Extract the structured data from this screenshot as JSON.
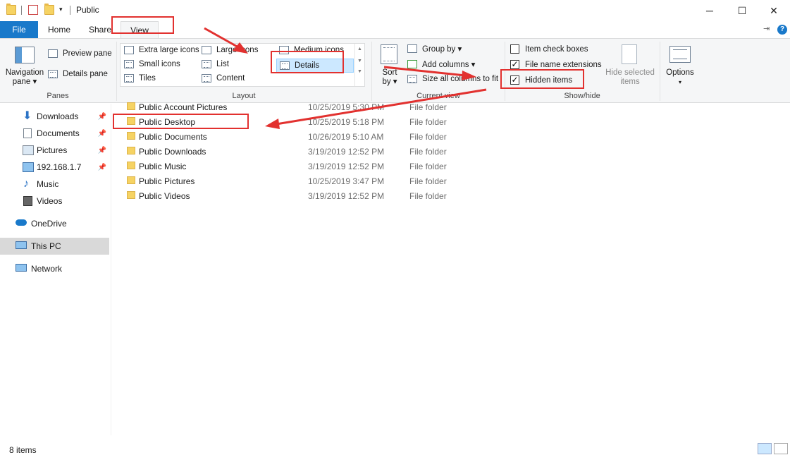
{
  "window": {
    "title": "Public",
    "controls": {
      "minimize": "─",
      "maximize": "☐",
      "close": "✕"
    }
  },
  "tabs": [
    {
      "label": "File"
    },
    {
      "label": "Home"
    },
    {
      "label": "Share"
    },
    {
      "label": "View"
    }
  ],
  "ribbon": {
    "panes": {
      "navigation_pane": "Navigation",
      "navigation_pane_2": "pane ▾",
      "preview_pane": "Preview pane",
      "details_pane": "Details pane",
      "label": "Panes"
    },
    "layout": {
      "items": [
        "Extra large icons",
        "Large icons",
        "Medium icons",
        "Small icons",
        "List",
        "Details",
        "Tiles",
        "Content"
      ],
      "selected": "Details",
      "label": "Layout"
    },
    "current_view": {
      "sort_by_1": "Sort",
      "sort_by_2": "by ▾",
      "group_by": "Group by ▾",
      "add_columns": "Add columns ▾",
      "size_all_columns": "Size all columns to fit",
      "label": "Current view"
    },
    "show_hide": {
      "item_check_boxes": {
        "label": "Item check boxes",
        "checked": false
      },
      "file_name_extensions": {
        "label": "File name extensions",
        "checked": true
      },
      "hidden_items": {
        "label": "Hidden items",
        "checked": true
      },
      "hide_selected_1": "Hide selected",
      "hide_selected_2": "items",
      "label": "Show/hide"
    },
    "options": {
      "label": "Options",
      "arrow": "▾"
    }
  },
  "nav": {
    "items": [
      {
        "label": "Downloads",
        "pinned": true
      },
      {
        "label": "Documents",
        "pinned": true
      },
      {
        "label": "Pictures",
        "pinned": true
      },
      {
        "label": "192.168.1.7",
        "pinned": true
      },
      {
        "label": "Music",
        "pinned": false
      },
      {
        "label": "Videos",
        "pinned": false
      },
      {
        "label": "OneDrive",
        "pinned": false
      },
      {
        "label": "This PC",
        "pinned": false
      },
      {
        "label": "Network",
        "pinned": false
      }
    ],
    "pin_glyph": "📌"
  },
  "files": [
    {
      "name": "Public Account Pictures",
      "date": "10/25/2019 5:30 PM",
      "type": "File folder"
    },
    {
      "name": "Public Desktop",
      "date": "10/25/2019 5:18 PM",
      "type": "File folder"
    },
    {
      "name": "Public Documents",
      "date": "10/26/2019 5:10 AM",
      "type": "File folder"
    },
    {
      "name": "Public Downloads",
      "date": "3/19/2019 12:52 PM",
      "type": "File folder"
    },
    {
      "name": "Public Music",
      "date": "3/19/2019 12:52 PM",
      "type": "File folder"
    },
    {
      "name": "Public Pictures",
      "date": "10/25/2019 3:47 PM",
      "type": "File folder"
    },
    {
      "name": "Public Videos",
      "date": "3/19/2019 12:52 PM",
      "type": "File folder"
    }
  ],
  "status": {
    "item_count": "8 items"
  },
  "colors": {
    "accent": "#1979ca",
    "annotation": "#e2312f",
    "folder": "#f6d363",
    "selected_nav": "#d9d9d9"
  }
}
